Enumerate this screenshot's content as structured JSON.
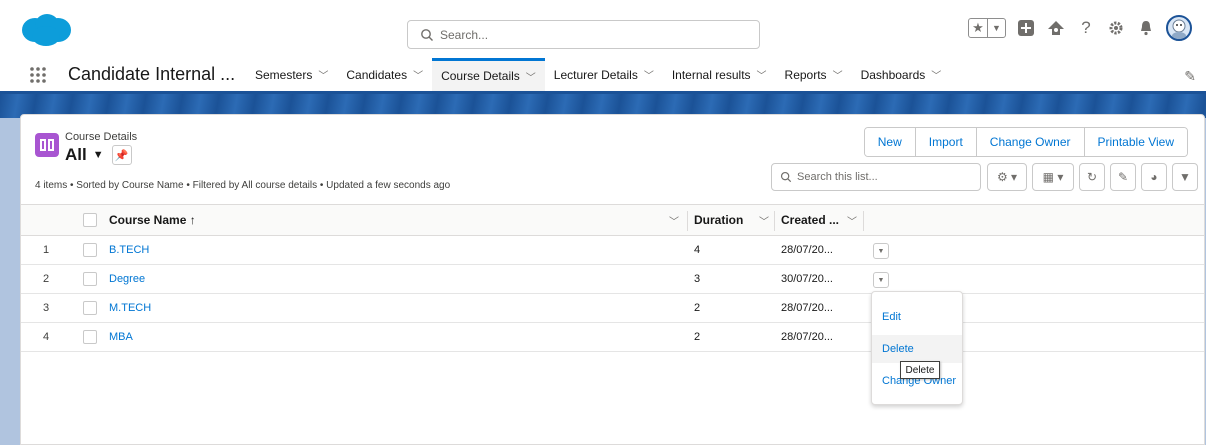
{
  "header": {
    "search_placeholder": "Search...",
    "help_glyph": "?"
  },
  "nav": {
    "app_name": "Candidate Internal ...",
    "items": [
      {
        "label": "Semesters",
        "active": false
      },
      {
        "label": "Candidates",
        "active": false
      },
      {
        "label": "Course Details",
        "active": true
      },
      {
        "label": "Lecturer Details",
        "active": false
      },
      {
        "label": "Internal results",
        "active": false
      },
      {
        "label": "Reports",
        "active": false
      },
      {
        "label": "Dashboards",
        "active": false
      }
    ]
  },
  "list_view": {
    "object_label": "Course Details",
    "list_name": "All",
    "actions": [
      "New",
      "Import",
      "Change Owner",
      "Printable View"
    ],
    "info": "4 items • Sorted by Course Name • Filtered by All course details • Updated a few seconds ago",
    "search_placeholder": "Search this list...",
    "columns": {
      "name": "Course Name ↑",
      "duration": "Duration",
      "created": "Created ..."
    },
    "rows": [
      {
        "num": "1",
        "name": "B.TECH",
        "duration": "4",
        "created": "28/07/20..."
      },
      {
        "num": "2",
        "name": "Degree",
        "duration": "3",
        "created": "30/07/20..."
      },
      {
        "num": "3",
        "name": "M.TECH",
        "duration": "2",
        "created": "28/07/20..."
      },
      {
        "num": "4",
        "name": "MBA",
        "duration": "2",
        "created": "28/07/20..."
      }
    ]
  },
  "row_menu": {
    "items": [
      "Edit",
      "Delete",
      "Change Owner"
    ],
    "hovered": "Delete",
    "tooltip": "Delete"
  },
  "colors": {
    "brand_blue": "#1b5297",
    "link_blue": "#0176d3",
    "object_icon": "#a855d1",
    "cloud_logo": "#0d9dda"
  },
  "icons": [
    "salesforce-logo",
    "search-icon",
    "star-icon",
    "chevron-down-icon",
    "add-icon",
    "trailhead-icon",
    "help-icon",
    "gear-icon",
    "bell-icon",
    "avatar",
    "waffle-icon",
    "pencil-icon",
    "pin-icon",
    "table-icon",
    "refresh-icon",
    "chart-icon",
    "filter-icon"
  ]
}
